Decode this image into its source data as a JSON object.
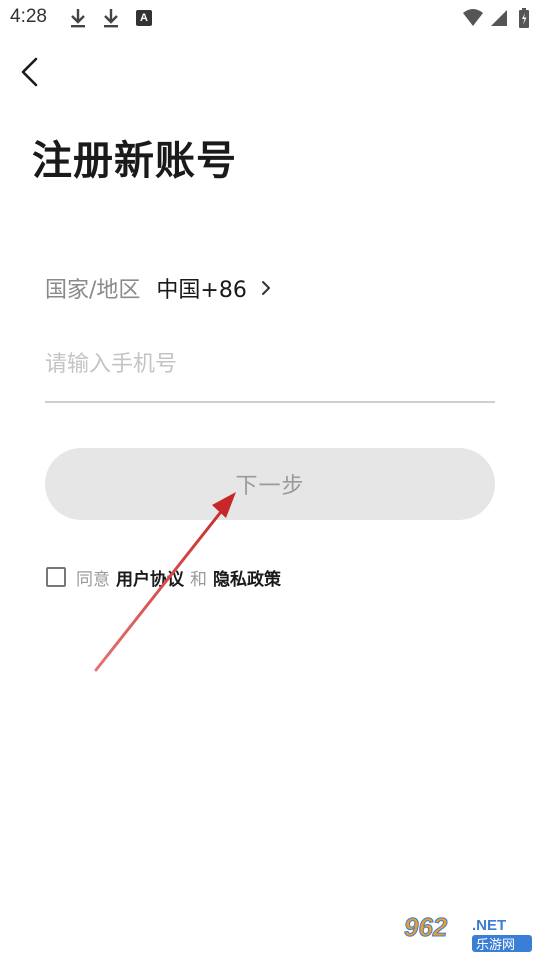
{
  "status_bar": {
    "time": "4:28",
    "icons": [
      "download-icon",
      "download-icon",
      "a-icon",
      "wifi-icon",
      "signal-icon",
      "battery-icon"
    ],
    "a_icon_text": "A"
  },
  "header": {
    "back_icon": "back-arrow-icon"
  },
  "page": {
    "title": "注册新账号"
  },
  "country": {
    "label": "国家/地区",
    "value": "中国+86"
  },
  "phone": {
    "placeholder": "请输入手机号",
    "value": ""
  },
  "next_button": {
    "label": "下一步"
  },
  "agreement": {
    "checked": false,
    "prefix": "同意",
    "user_agreement": "用户协议",
    "and": "和",
    "privacy_policy": "隐私政策"
  },
  "watermark": {
    "number": "962",
    "suffix": ".NET",
    "text": "乐游网"
  },
  "colors": {
    "button_bg": "#e6e6e6",
    "arrow": "#d32f2f",
    "watermark_blue": "#3a7fd5",
    "watermark_orange": "#f39c26"
  }
}
